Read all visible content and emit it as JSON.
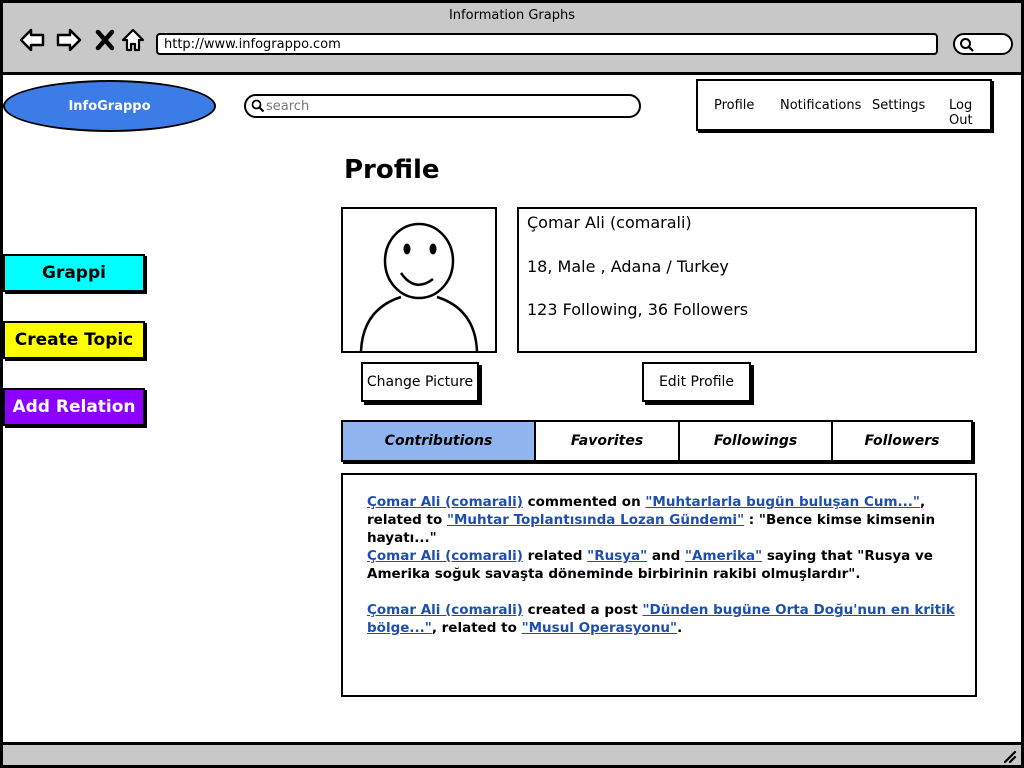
{
  "window": {
    "title": "Information Graphs"
  },
  "browser": {
    "url": "http://www.infograppo.com",
    "icons": [
      "back-arrow-icon",
      "forward-arrow-icon",
      "close-x-icon",
      "home-icon",
      "search-icon"
    ]
  },
  "header": {
    "logo_text": "InfoGrappo",
    "search_placeholder": "search",
    "nav": [
      "Profile",
      "Notifications",
      "Settings",
      "Log Out"
    ]
  },
  "sidebar": {
    "buttons": [
      {
        "label": "Grappi",
        "color": "#00ffff",
        "text_color": "#000000"
      },
      {
        "label": "Create Topic",
        "color": "#ffff00",
        "text_color": "#000000"
      },
      {
        "label": "Add Relation",
        "color": "#8b00ff",
        "text_color": "#ffffff"
      }
    ]
  },
  "profile": {
    "title": "Profile",
    "name_line": "Çomar Ali (comarali)",
    "details_line": "18, Male , Adana / Turkey",
    "follow_line": "123 Following, 36 Followers",
    "change_picture_label": "Change Picture",
    "edit_profile_label": "Edit Profile"
  },
  "tabs": [
    {
      "label": "Contributions",
      "active": true
    },
    {
      "label": "Favorites",
      "active": false
    },
    {
      "label": "Followings",
      "active": false
    },
    {
      "label": "Followers",
      "active": false
    }
  ],
  "activities": {
    "a1": {
      "user": "Çomar Ali (comarali)",
      "t1": " commented on ",
      "l1": "\"Muhtarlarla bugün buluşan Cum...\"",
      "t2": ", related to ",
      "l2": "\"Muhtar Toplantısında Lozan Gündemi\"",
      "t3": " : \"Bence kimse kimsenin hayatı...\""
    },
    "a2": {
      "user": "Çomar Ali (comarali)",
      "t1": " related ",
      "l1": "\"Rusya\"",
      "t2": " and ",
      "l2": "\"Amerika\"",
      "t3": " saying that \"Rusya ve Amerika soğuk savaşta döneminde birbirinin rakibi olmuşlardır\"."
    },
    "a3": {
      "user": "Çomar Ali (comarali)",
      "t1": " created a post ",
      "l1": "\"Dünden bugüne Orta Doğu'nun en kritik bölge...\"",
      "t2": ", related to ",
      "l2": "\"Musul Operasyonu\"",
      "t3": "."
    }
  },
  "colors": {
    "logo": "#3b7ce6",
    "active_tab": "#8fb4ee",
    "link": "#1f4fae",
    "chrome": "#c8c8c8"
  }
}
